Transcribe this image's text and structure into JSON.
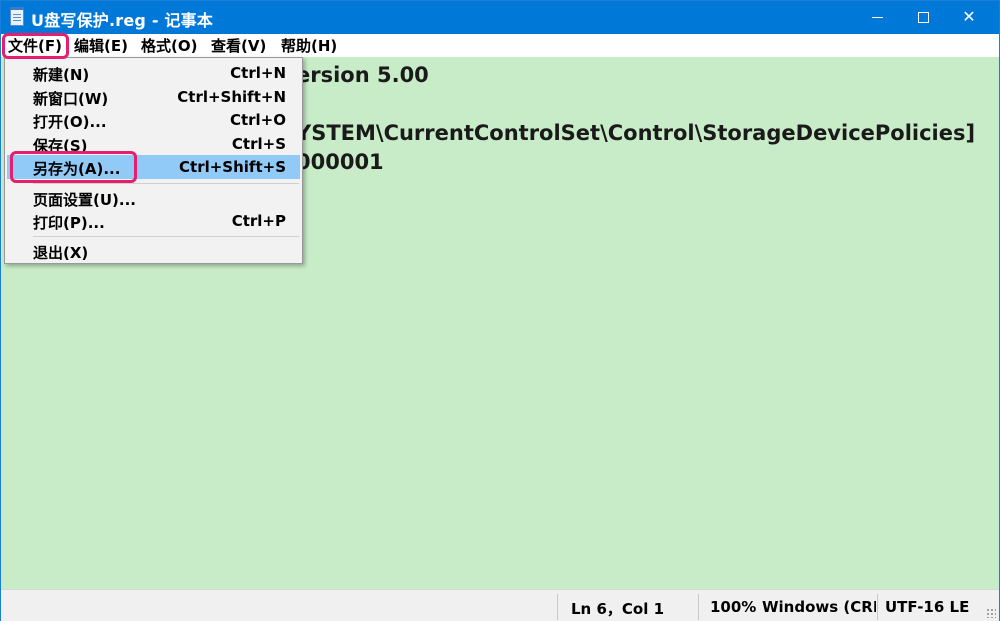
{
  "window": {
    "title": "U盘写保护.reg - 记事本",
    "controls": {
      "minimize": "minimize",
      "maximize": "maximize",
      "close": "✕"
    }
  },
  "menubar": {
    "file": "文件(F)",
    "edit": "编辑(E)",
    "format": "格式(O)",
    "view": "查看(V)",
    "help": "帮助(H)"
  },
  "file_menu": {
    "items": [
      {
        "label": "新建(N)",
        "shortcut": "Ctrl+N"
      },
      {
        "label": "新窗口(W)",
        "shortcut": "Ctrl+Shift+N"
      },
      {
        "label": "打开(O)...",
        "shortcut": "Ctrl+O"
      },
      {
        "label": "保存(S)",
        "shortcut": "Ctrl+S"
      },
      {
        "label": "另存为(A)...",
        "shortcut": "Ctrl+Shift+S",
        "selected": true
      },
      {
        "label": "页面设置(U)...",
        "shortcut": ""
      },
      {
        "label": "打印(P)...",
        "shortcut": "Ctrl+P"
      },
      {
        "label": "退出(X)",
        "shortcut": ""
      }
    ]
  },
  "editor": {
    "background": "#c8ecc8",
    "visible_lines": [
      "ersion 5.00",
      "YSTEM\\CurrentControlSet\\Control\\StorageDevicePolicies]",
      "000001"
    ]
  },
  "statusbar": {
    "position": "Ln 6，Col 1",
    "zoom": "100%",
    "line_ending": "Windows (CRLF)",
    "encoding": "UTF-16 LE"
  },
  "colors": {
    "titlebar": "#0078d7",
    "highlight_border": "#e61e6e",
    "menu_selected": "#91c9f7"
  }
}
